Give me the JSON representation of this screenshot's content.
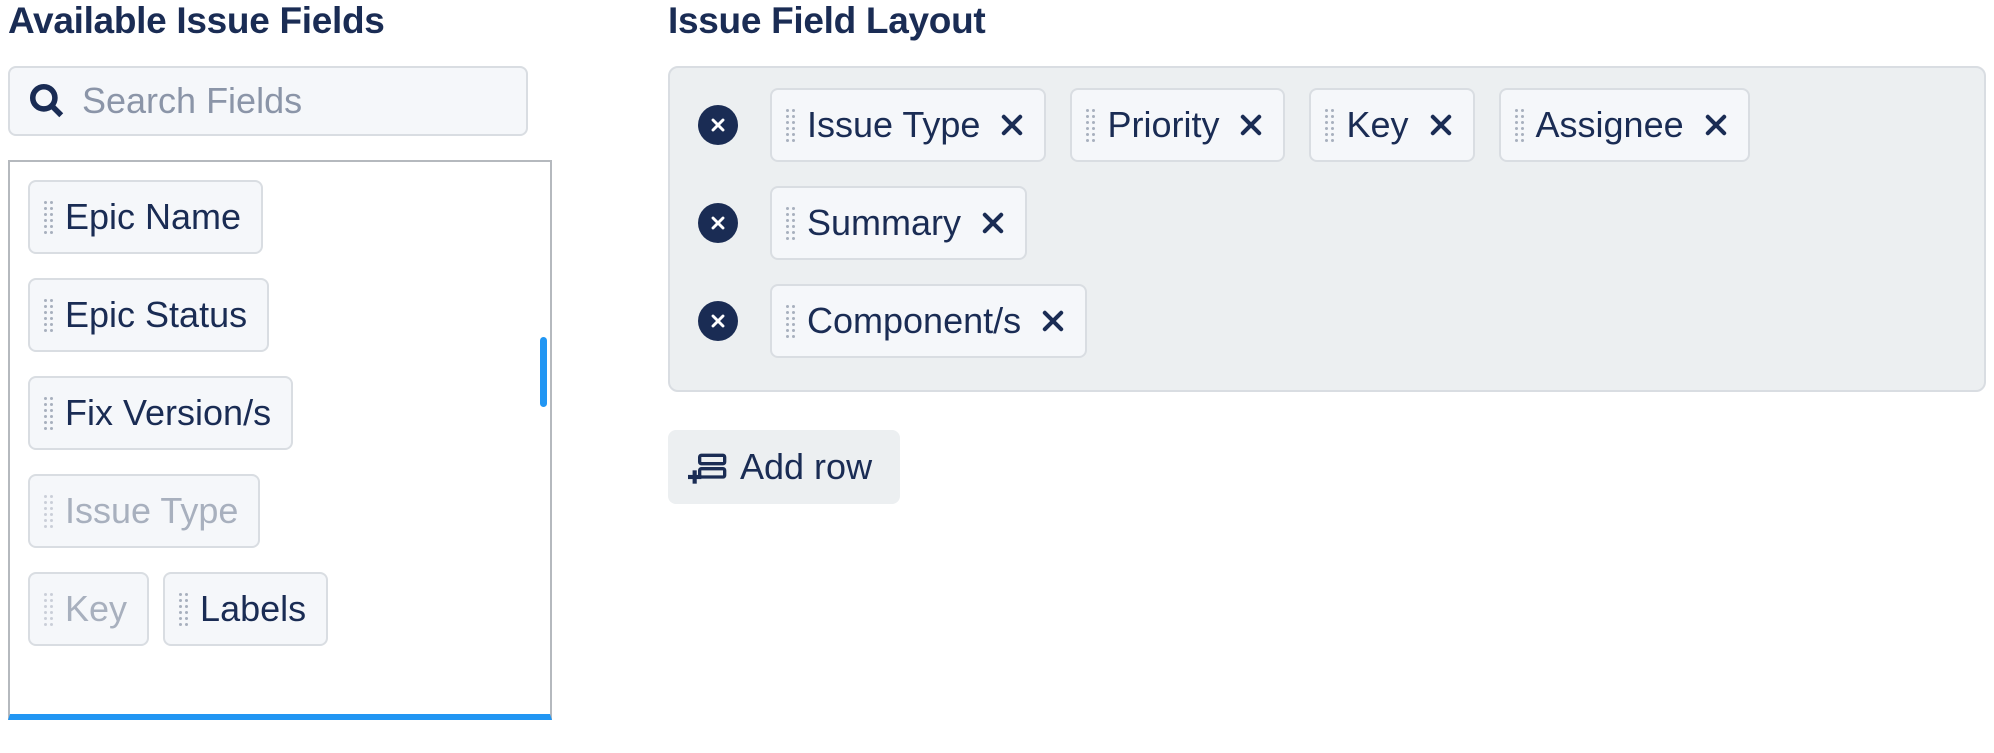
{
  "left": {
    "title": "Available Issue Fields",
    "search_placeholder": "Search Fields",
    "fields": [
      {
        "label": "Epic Name",
        "disabled": false
      },
      {
        "label": "Epic Status",
        "disabled": false
      },
      {
        "label": "Fix Version/s",
        "disabled": false
      },
      {
        "label": "Issue Type",
        "disabled": true
      },
      {
        "label": "Key",
        "disabled": true
      },
      {
        "label": "Labels",
        "disabled": false
      }
    ]
  },
  "right": {
    "title": "Issue Field Layout",
    "rows": [
      {
        "fields": [
          "Issue Type",
          "Priority",
          "Key",
          "Assignee"
        ]
      },
      {
        "fields": [
          "Summary"
        ]
      },
      {
        "fields": [
          "Component/s"
        ]
      }
    ],
    "add_row_label": "Add row"
  }
}
